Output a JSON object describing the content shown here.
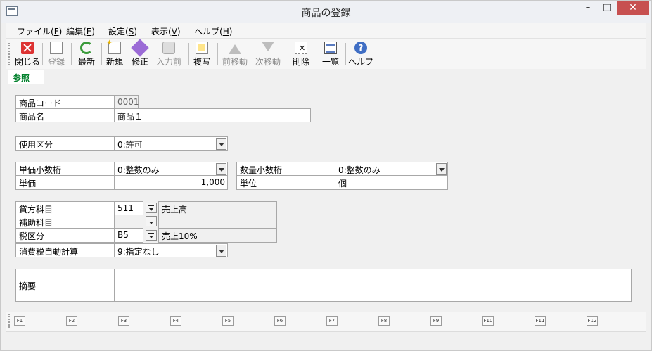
{
  "window": {
    "title": "商品の登録",
    "minimize": "–",
    "maximize": "□",
    "close": "✕"
  },
  "menu": [
    {
      "label": "ファイル(",
      "key": "F",
      "end": ")"
    },
    {
      "label": "編集(",
      "key": "E",
      "end": ")"
    },
    {
      "label": "設定(",
      "key": "S",
      "end": ")"
    },
    {
      "label": "表示(",
      "key": "V",
      "end": ")"
    },
    {
      "label": "ヘルプ(",
      "key": "H",
      "end": ")"
    }
  ],
  "toolbar": {
    "close": "閉じる",
    "register": "登録",
    "refresh": "最新",
    "new": "新規",
    "edit": "修正",
    "input_before": "入力前",
    "copy": "複写",
    "prev": "前移動",
    "next": "次移動",
    "delete": "削除",
    "list": "一覧",
    "help": "ヘルプ"
  },
  "tab": {
    "reference": "参照"
  },
  "form": {
    "product_code": {
      "label": "商品コード",
      "value": "0001"
    },
    "product_name": {
      "label": "商品名",
      "value": "商品１"
    },
    "usage": {
      "label": "使用区分",
      "value": "0:許可"
    },
    "unit_price_decimals": {
      "label": "単価小数桁",
      "value": "0:整数のみ"
    },
    "qty_decimals": {
      "label": "数量小数桁",
      "value": "0:整数のみ"
    },
    "unit_price": {
      "label": "単価",
      "value": "1,000"
    },
    "unit": {
      "label": "単位",
      "value": "個"
    },
    "credit_account": {
      "label": "貸方科目",
      "code": "511",
      "name": "売上高"
    },
    "sub_account": {
      "label": "補助科目",
      "code": "",
      "name": ""
    },
    "tax_category": {
      "label": "税区分",
      "code": "B5",
      "name": "売上10%"
    },
    "auto_tax": {
      "label": "消費税自動計算",
      "value": "9:指定なし"
    },
    "memo": {
      "label": "摘要",
      "value": ""
    }
  },
  "fkeys": [
    "F1",
    "F2",
    "F3",
    "F4",
    "F5",
    "F6",
    "F7",
    "F8",
    "F9",
    "F10",
    "F11",
    "F12"
  ]
}
